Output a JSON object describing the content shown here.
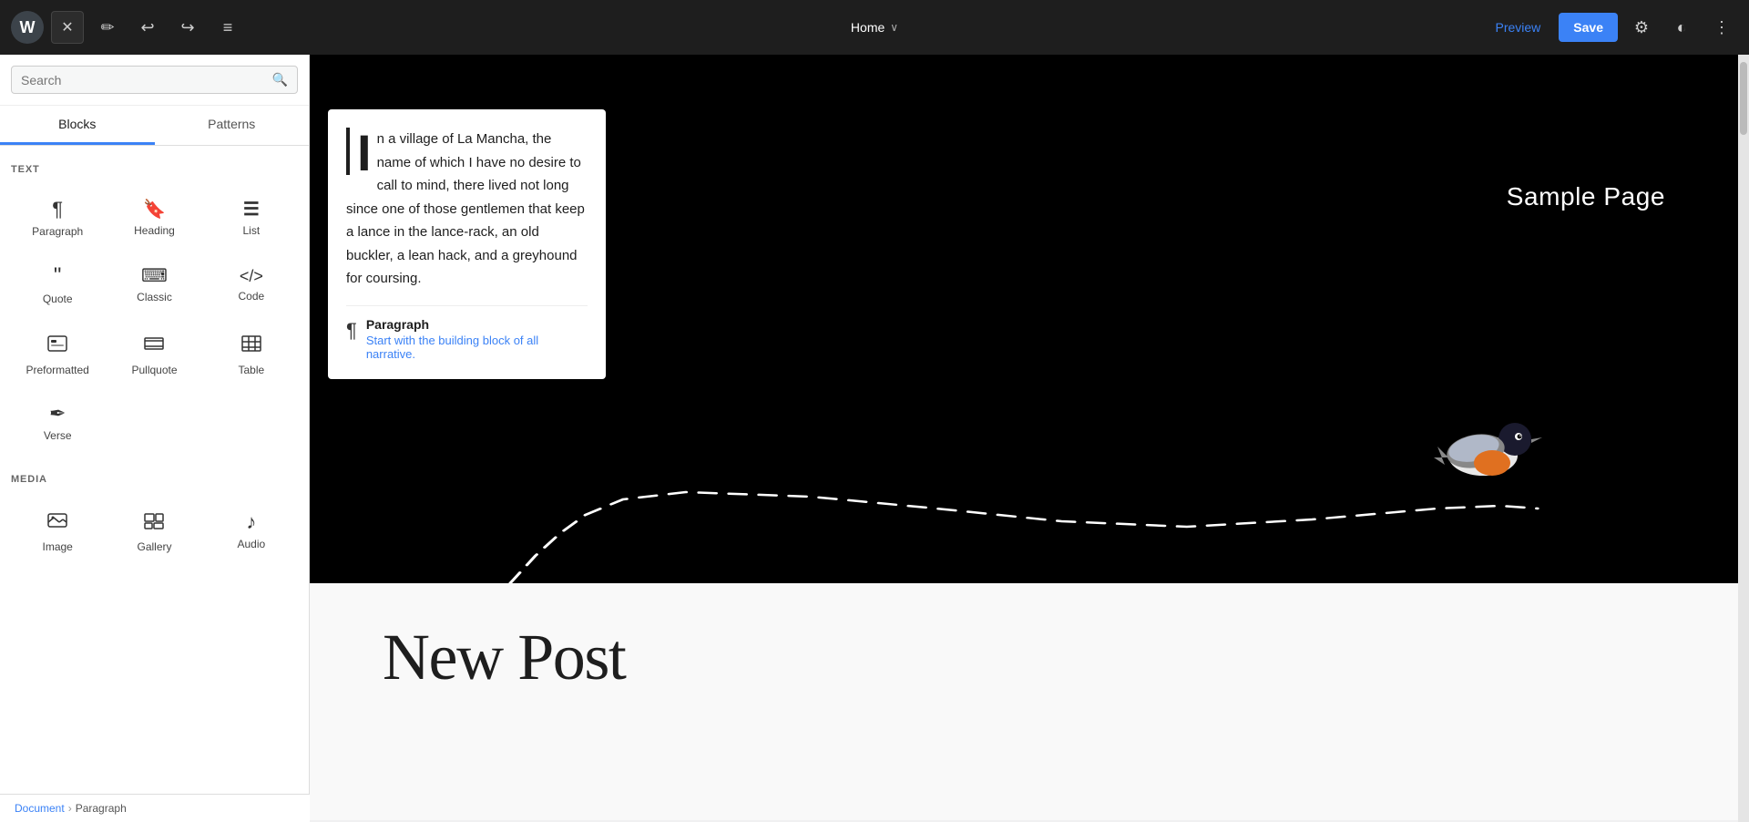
{
  "toolbar": {
    "wp_logo": "W",
    "close_label": "✕",
    "edit_icon": "✏",
    "undo_icon": "↩",
    "redo_icon": "↪",
    "list_icon": "≡",
    "page_title": "Home",
    "chevron": "∨",
    "preview_label": "Preview",
    "save_label": "Save",
    "gear_icon": "⚙",
    "contrast_icon": "◐",
    "more_icon": "⋮"
  },
  "sidebar": {
    "search_placeholder": "Search",
    "search_icon": "🔍",
    "tabs": [
      {
        "id": "blocks",
        "label": "Blocks",
        "active": true
      },
      {
        "id": "patterns",
        "label": "Patterns",
        "active": false
      }
    ],
    "sections": [
      {
        "label": "TEXT",
        "blocks": [
          {
            "id": "paragraph",
            "icon": "¶",
            "label": "Paragraph"
          },
          {
            "id": "heading",
            "icon": "🔖",
            "label": "Heading"
          },
          {
            "id": "list",
            "icon": "≡",
            "label": "List"
          },
          {
            "id": "quote",
            "icon": "❝",
            "label": "Quote"
          },
          {
            "id": "classic",
            "icon": "⌨",
            "label": "Classic"
          },
          {
            "id": "code",
            "icon": "<>",
            "label": "Code"
          },
          {
            "id": "preformatted",
            "icon": "⊞",
            "label": "Preformatted"
          },
          {
            "id": "pullquote",
            "icon": "▭",
            "label": "Pullquote"
          },
          {
            "id": "table",
            "icon": "⊞",
            "label": "Table"
          },
          {
            "id": "verse",
            "icon": "✒",
            "label": "Verse"
          }
        ]
      },
      {
        "label": "MEDIA",
        "blocks": [
          {
            "id": "image",
            "icon": "⊟",
            "label": "Image"
          },
          {
            "id": "gallery",
            "icon": "⊞",
            "label": "Gallery"
          },
          {
            "id": "audio",
            "icon": "♪",
            "label": "Audio"
          }
        ]
      }
    ]
  },
  "editor": {
    "popup": {
      "text": "n a village of La Mancha, the name of which I have no desire to call to mind, there lived not long since one of those gentlemen that keep a lance in the lance-rack, an old buckler, a lean hack, and a greyhound for coursing.",
      "paragraph_label": "Paragraph",
      "paragraph_hint": "Start with the building block of all narrative."
    },
    "sample_page": "Sample Page",
    "new_post_title": "New Post"
  },
  "breadcrumb": {
    "document": "Document",
    "separator": "›",
    "current": "Paragraph"
  }
}
